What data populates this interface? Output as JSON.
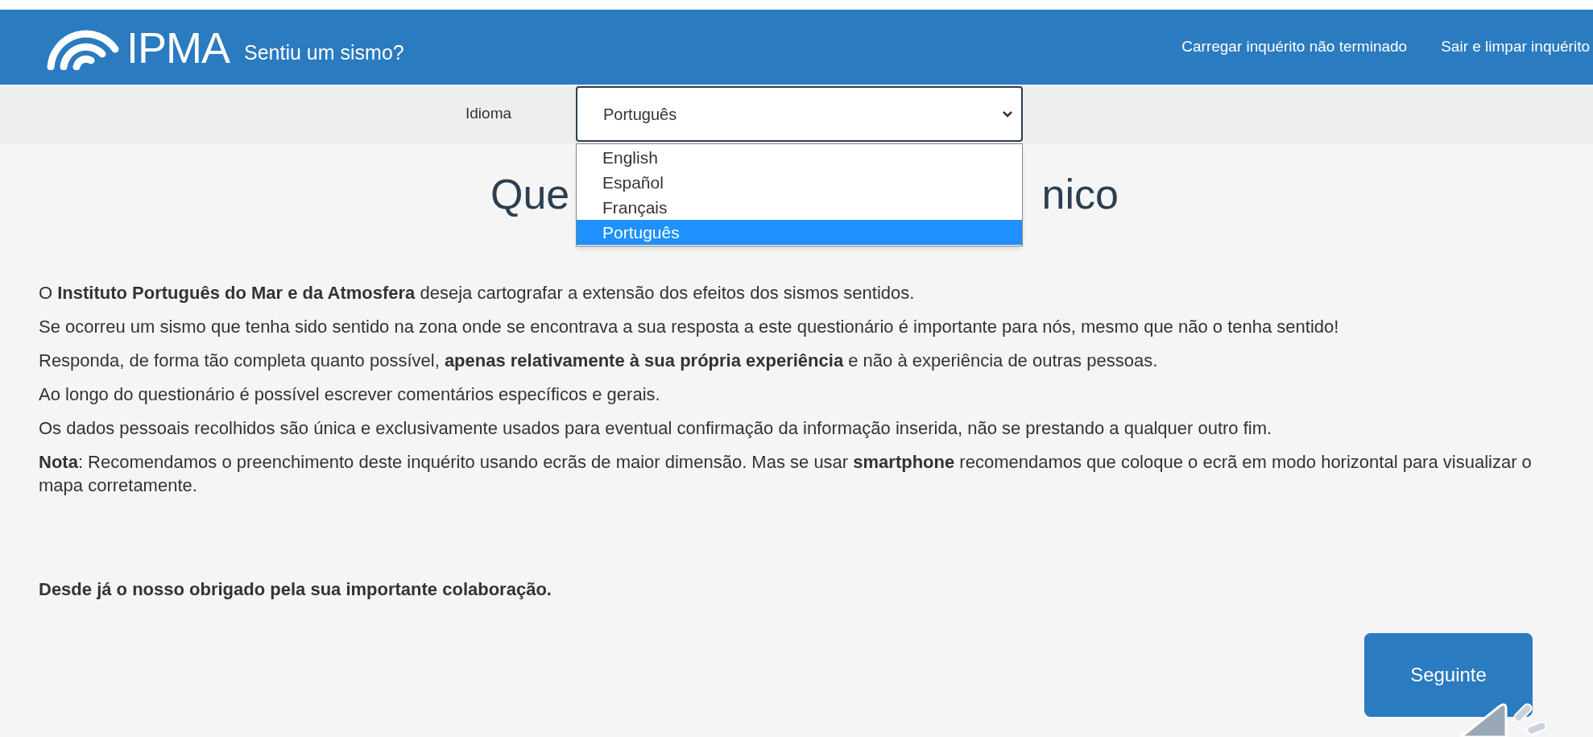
{
  "header": {
    "logo": "IPMA",
    "title": "Sentiu um sismo?",
    "links": [
      "Carregar inquérito não terminado",
      "Sair e limpar inquérito"
    ]
  },
  "language": {
    "label": "Idioma",
    "value": "Português",
    "options": [
      {
        "label": "English",
        "selected": false
      },
      {
        "label": "Español",
        "selected": false
      },
      {
        "label": "Français",
        "selected": false
      },
      {
        "label": "Português",
        "selected": true
      }
    ]
  },
  "heading": {
    "visible_start": "Que",
    "visible_end": "nico"
  },
  "paragraphs": [
    "O **Instituto Português do Mar e da Atmosfera** deseja cartografar a extensão dos efeitos dos sismos sentidos.",
    "Se ocorreu um sismo que tenha sido sentido na zona onde se encontrava a sua resposta a este questionário é importante para nós, mesmo que não o tenha sentido!",
    "Responda, de forma tão completa quanto possível, **apenas relativamente à sua própria experiência** e não à experiência de outras pessoas.",
    "Ao longo do questionário é possível escrever comentários específicos e gerais.",
    "Os dados pessoais recolhidos são única e exclusivamente usados para eventual confirmação da informação inserida, não se prestando a qualquer outro fim.",
    "**Nota**: Recomendamos o preenchimento deste inquérito usando ecrãs de maior dimensão. Mas se usar **smartphone** recomendamos que coloque o ecrã em modo horizontal para visualizar o mapa corretamente."
  ],
  "closing": "Desde já o nosso obrigado pela sua importante colaboração.",
  "next_button": "Seguinte"
}
